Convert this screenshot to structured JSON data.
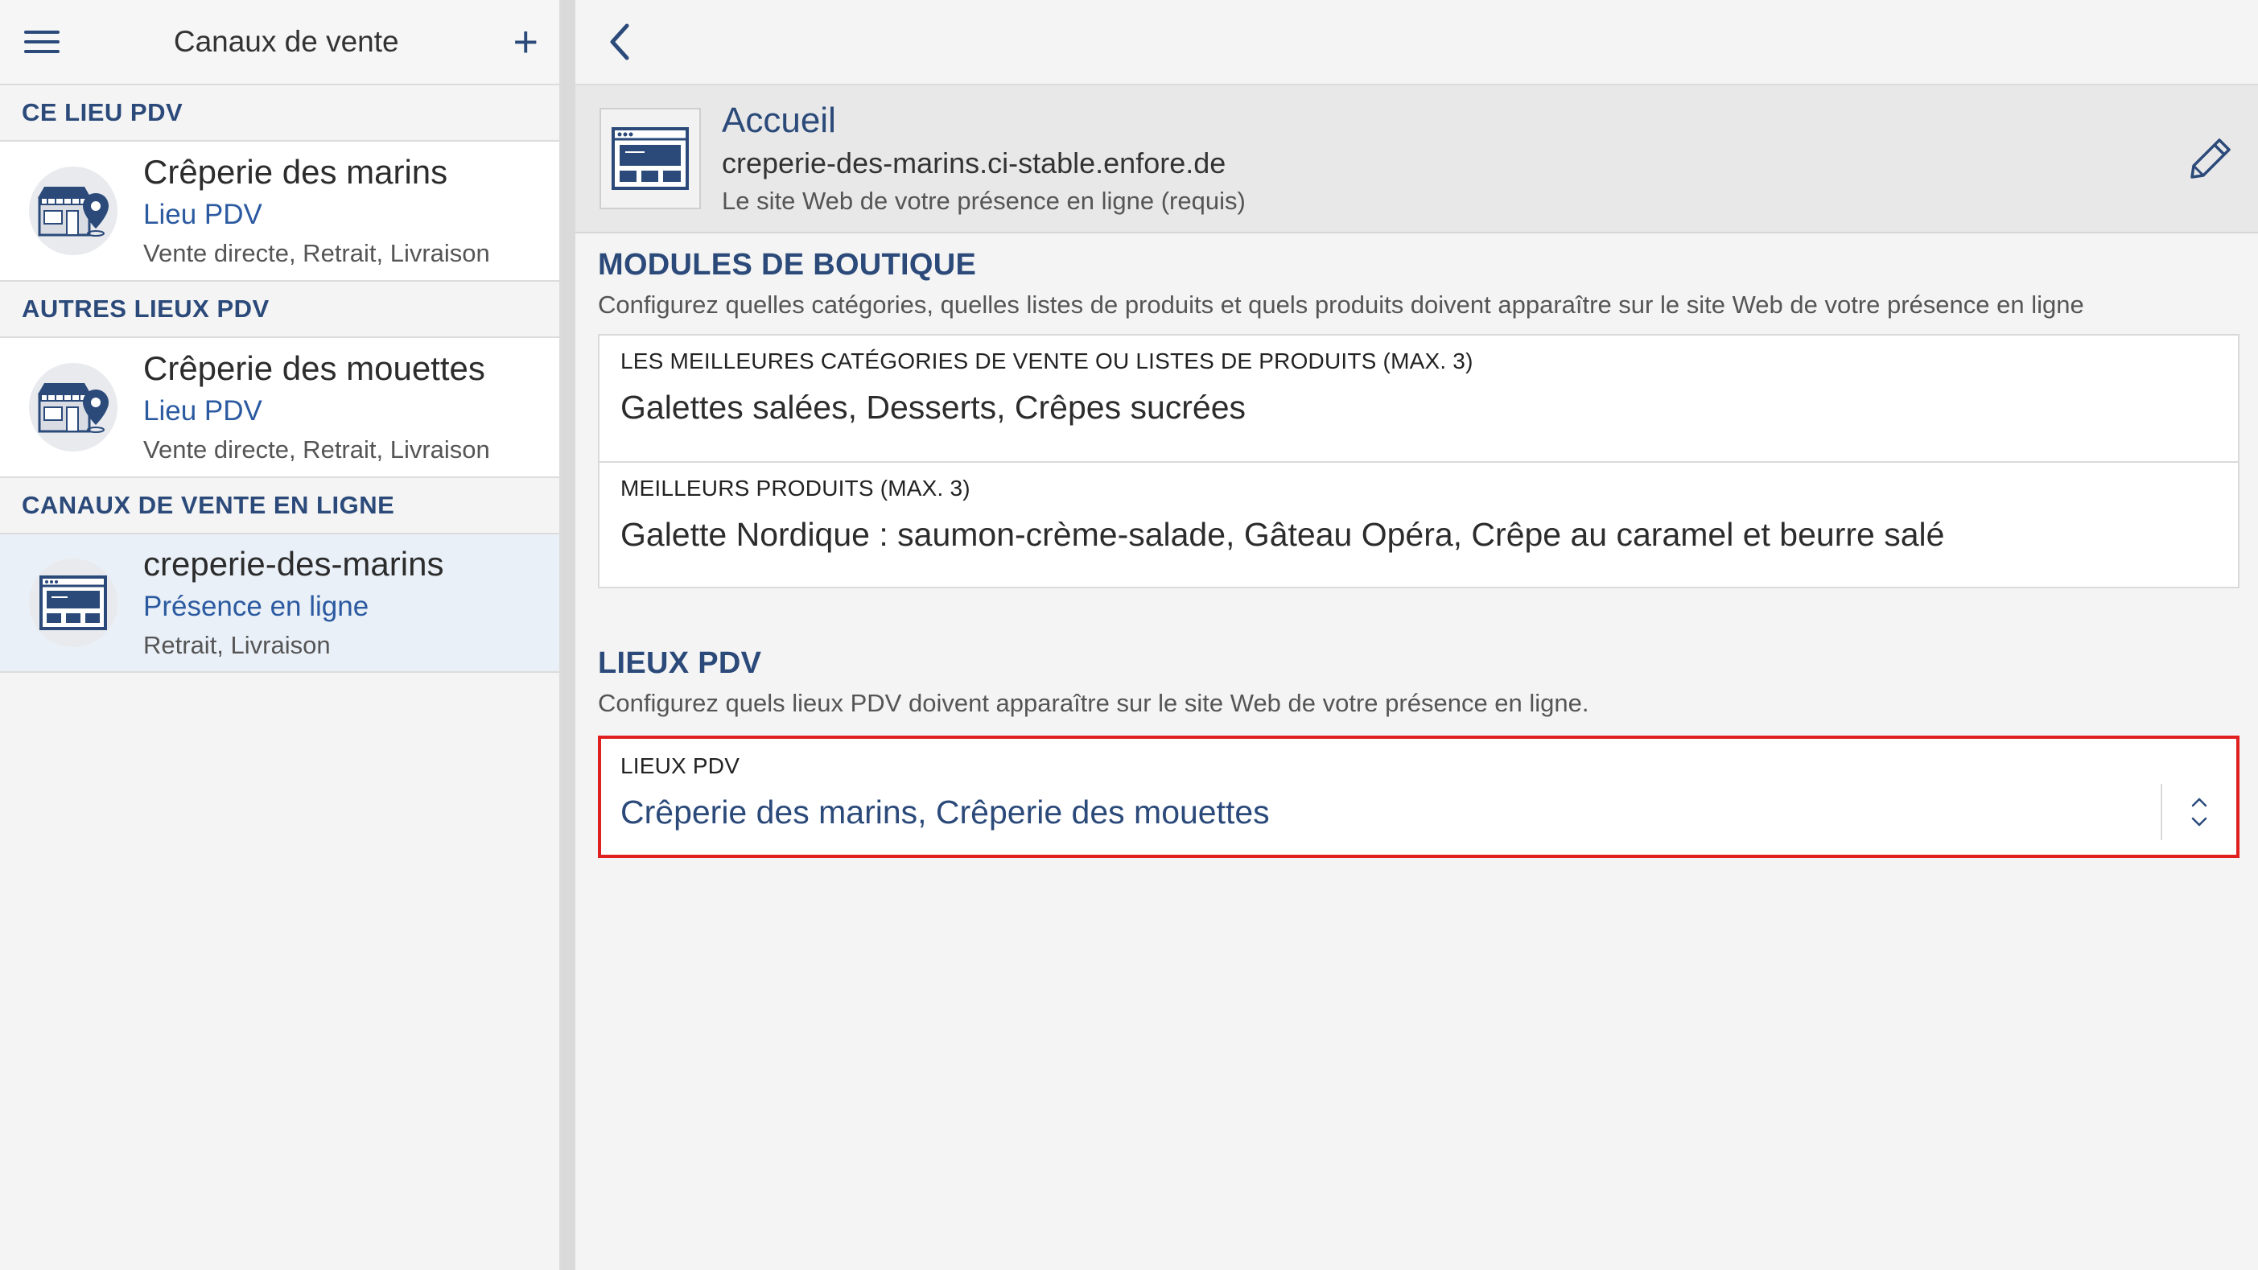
{
  "left": {
    "header_title": "Canaux de vente",
    "sections": [
      {
        "label": "CE LIEU PDV",
        "items": [
          {
            "name": "Crêperie des marins",
            "type": "Lieu PDV",
            "desc": "Vente directe, Retrait, Livraison",
            "icon": "store-location-icon"
          }
        ]
      },
      {
        "label": "AUTRES LIEUX PDV",
        "items": [
          {
            "name": "Crêperie des mouettes",
            "type": "Lieu PDV",
            "desc": "Vente directe, Retrait, Livraison",
            "icon": "store-location-icon"
          }
        ]
      },
      {
        "label": "CANAUX DE VENTE EN LIGNE",
        "items": [
          {
            "name": "creperie-des-marins",
            "type": "Présence en ligne",
            "desc": "Retrait, Livraison",
            "icon": "website-icon"
          }
        ]
      }
    ]
  },
  "site": {
    "title": "Accueil",
    "url": "creperie-des-marins.ci-stable.enfore.de",
    "desc": "Le site Web de votre présence en ligne (requis)"
  },
  "modules": {
    "title": "MODULES DE BOUTIQUE",
    "desc": "Configurez quelles catégories, quelles listes de produits et quels produits doivent apparaître sur le site Web de votre présence en ligne",
    "fields": [
      {
        "label": "LES MEILLEURES CATÉGORIES DE VENTE OU LISTES DE PRODUITS (MAX. 3)",
        "value": "Galettes salées, Desserts, Crêpes sucrées"
      },
      {
        "label": "MEILLEURS PRODUITS (MAX. 3)",
        "value": "Galette Nordique : saumon-crème-salade, Gâteau Opéra, Crêpe au caramel et beurre salé"
      }
    ]
  },
  "pos": {
    "title": "LIEUX PDV",
    "desc": "Configurez quels lieux PDV doivent apparaître sur le site Web de votre présence en ligne.",
    "field_label": "LIEUX PDV",
    "field_value": "Crêperie des marins, Crêperie des mouettes"
  },
  "colors": {
    "accent": "#2b4a7a",
    "link_blue": "#2b5aa0",
    "highlight_border": "#e02020",
    "selected_bg": "#eaf0f8"
  }
}
